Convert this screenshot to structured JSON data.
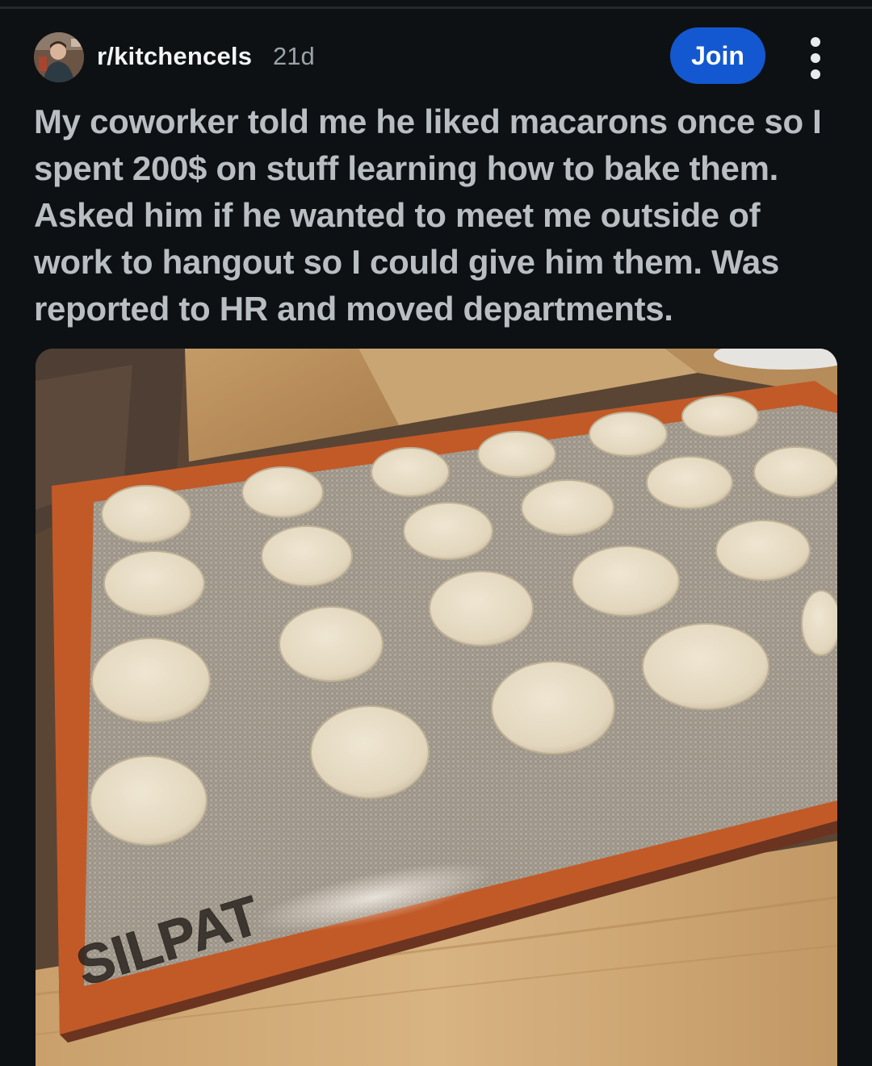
{
  "post": {
    "subreddit": "r/kitchencels",
    "age": "21d",
    "join_label": "Join",
    "more_icon": "more-vertical-icon",
    "title": "My coworker told me he liked macarons once so I spent 200$ on stuff learning how to bake them. Asked him if he wanted to meet me outside of work to hangout so I could give him them. Was reported to HR and moved departments.",
    "image": {
      "mat_brand": "SILPAT"
    }
  },
  "colors": {
    "background": "#0e1113",
    "join_button": "#1358d0",
    "title_text": "#b8bec2",
    "meta_text": "#9aa3a8"
  }
}
